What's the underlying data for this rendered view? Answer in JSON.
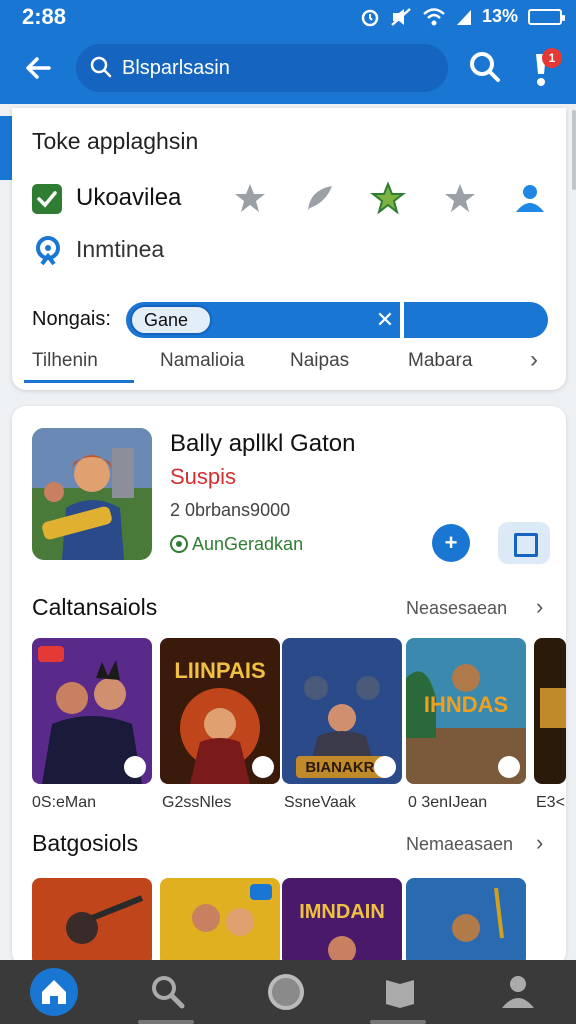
{
  "status": {
    "time": "2:88",
    "battery": "13%"
  },
  "appbar": {
    "search_text": "Blsparlsasin",
    "notif_count": "1"
  },
  "filters": {
    "title": "Toke applaghsin",
    "item1": "Ukoavilea",
    "item2": "Inmtinea",
    "range_label": "Nongais:",
    "range_chip": "Gane",
    "tabs": [
      "Tilhenin",
      "Namalioia",
      "Naipas",
      "Mabara"
    ]
  },
  "featured": {
    "title": "Bally apllkl Gaton",
    "subtitle": "Suspis",
    "meta": "2 0brbans9000",
    "verified": "AunGeradkan"
  },
  "section1": {
    "title": "Caltansaiols",
    "more": "Neasesaean",
    "items": [
      {
        "label": "0S:eMan",
        "art": ""
      },
      {
        "label": "G2ssNles",
        "art": "LIINPAIS"
      },
      {
        "label": "SsneVaak",
        "art": "BIANAKRI"
      },
      {
        "label": "0 3enIJean",
        "art": "IHNDAS"
      },
      {
        "label": "E3<",
        "art": ""
      }
    ]
  },
  "section2": {
    "title": "Batgosiols",
    "more": "Nemaeasaen",
    "items": [
      {
        "art": ""
      },
      {
        "art": ""
      },
      {
        "art": "IMNDAIN"
      },
      {
        "art": ""
      }
    ]
  },
  "colors": {
    "primary": "#1976d2",
    "accent_red": "#d32f2f",
    "accent_green": "#2e7d32"
  }
}
